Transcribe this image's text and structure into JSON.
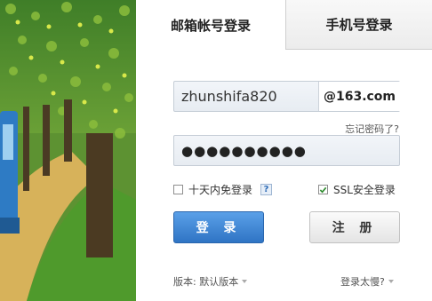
{
  "tabs": {
    "email_login": "邮箱帐号登录",
    "phone_login": "手机号登录"
  },
  "login_form": {
    "username_value": "zhunshifa820",
    "domain": "@163.com",
    "forgot_password": "忘记密码了?",
    "password_mask": "●●●●●●●●●●",
    "remember_10_days": "十天内免登录",
    "help_icon_text": "?",
    "ssl_login": "SSL安全登录",
    "ssl_checked": true,
    "remember_checked": false
  },
  "buttons": {
    "login": "登 录",
    "register": "注 册"
  },
  "footer": {
    "version_label": "版本: 默认版本",
    "slow_login": "登录太慢?"
  },
  "colors": {
    "login_button": "#3b82d2",
    "sky": "#2f83c7",
    "grass": "#4f9a2c"
  }
}
